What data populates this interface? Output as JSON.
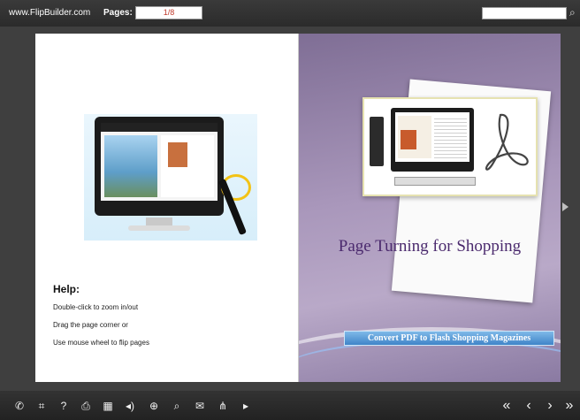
{
  "topbar": {
    "site": "www.FlipBuilder.com",
    "pages_label": "Pages:",
    "pages_value": "1/8",
    "search_placeholder": ""
  },
  "left_page": {
    "help_title": "Help:",
    "help_lines": [
      "Double-click to zoom in/out",
      "Drag the page corner or",
      "Use mouse wheel to flip pages"
    ]
  },
  "right_page": {
    "slogan": "Page Turning for Shopping",
    "convert_button": "Convert PDF to  Flash Shopping Magazines"
  },
  "toolbar": {
    "left_icons": [
      "phone-icon",
      "fit-screen-icon",
      "help-icon",
      "print-icon",
      "thumbnails-icon",
      "sound-icon",
      "zoom-in-icon",
      "search-icon",
      "email-icon",
      "share-icon",
      "play-icon"
    ],
    "glyphs": {
      "phone": "✆",
      "fit": "⌗",
      "help": "?",
      "print": "⎙",
      "thumbs": "▦",
      "sound": "◂)",
      "zoomin": "⊕",
      "search": "⌕",
      "email": "✉",
      "share": "⋔",
      "play": "▸",
      "first": "«",
      "prev": "‹",
      "next": "›",
      "last": "»"
    }
  },
  "colors": {
    "topbar": "#2b2b2b",
    "page_right_bg": "#a997bb",
    "slogan": "#4b2a6e",
    "convert_button": "#3f84c8",
    "pages_value": "#c0392b"
  }
}
